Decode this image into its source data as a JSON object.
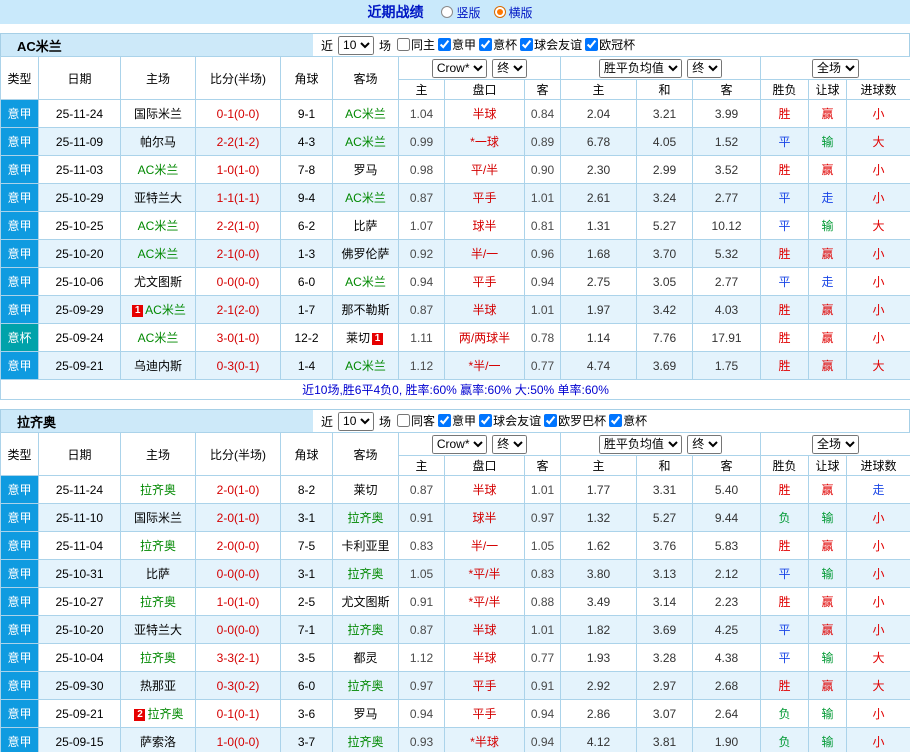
{
  "page": {
    "title": "近期战绩",
    "layout_options": [
      {
        "label": "竖版",
        "selected": false
      },
      {
        "label": "横版",
        "selected": true
      }
    ]
  },
  "labels": {
    "recent": "近",
    "games": "场"
  },
  "columns": {
    "type": "类型",
    "date": "日期",
    "home": "主场",
    "score": "比分(半场)",
    "corner": "角球",
    "away": "客场",
    "h": "主",
    "handicap": "盘口",
    "a": "客",
    "eh": "主",
    "draw": "和",
    "ea": "客",
    "result": "胜负",
    "let": "让球",
    "goals": "进球数"
  },
  "controls": {
    "company": "Crow*",
    "final": "终",
    "eu_mean": "胜平负均值",
    "scope": "全场"
  },
  "colors": {
    "league": {
      "意甲": "#0f9be0",
      "意杯": "#00a2aa"
    },
    "subject_team": "#008800",
    "win": "#e00000",
    "draw": "#1a46e6",
    "lose": "#009933",
    "link_blue": "#0017c4"
  },
  "sections": [
    {
      "team": "AC米兰",
      "count": "10",
      "filters": [
        {
          "label": "同主",
          "checked": false
        },
        {
          "label": "意甲",
          "checked": true
        },
        {
          "label": "意杯",
          "checked": true
        },
        {
          "label": "球会友谊",
          "checked": true
        },
        {
          "label": "欧冠杯",
          "checked": true
        }
      ],
      "rows": [
        {
          "league": "意甲",
          "date": "25-11-24",
          "home": "国际米兰",
          "home_green": false,
          "home_badge": "",
          "score": "0-1(0-0)",
          "corner": "9-1",
          "away": "AC米兰",
          "away_green": true,
          "away_badge": "",
          "odds_home": "1.04",
          "handicap": "半球",
          "odds_away": "0.84",
          "eu_home": "2.04",
          "eu_draw": "3.21",
          "eu_away": "3.99",
          "result": "胜",
          "handicap_result": "赢",
          "goals_result": "小"
        },
        {
          "league": "意甲",
          "date": "25-11-09",
          "home": "帕尔马",
          "home_green": false,
          "home_badge": "",
          "score": "2-2(1-2)",
          "corner": "4-3",
          "away": "AC米兰",
          "away_green": true,
          "away_badge": "",
          "odds_home": "0.99",
          "handicap": "*一球",
          "odds_away": "0.89",
          "eu_home": "6.78",
          "eu_draw": "4.05",
          "eu_away": "1.52",
          "result": "平",
          "handicap_result": "输",
          "goals_result": "大"
        },
        {
          "league": "意甲",
          "date": "25-11-03",
          "home": "AC米兰",
          "home_green": true,
          "home_badge": "",
          "score": "1-0(1-0)",
          "corner": "7-8",
          "away": "罗马",
          "away_green": false,
          "away_badge": "",
          "odds_home": "0.98",
          "handicap": "平/半",
          "odds_away": "0.90",
          "eu_home": "2.30",
          "eu_draw": "2.99",
          "eu_away": "3.52",
          "result": "胜",
          "handicap_result": "赢",
          "goals_result": "小"
        },
        {
          "league": "意甲",
          "date": "25-10-29",
          "home": "亚特兰大",
          "home_green": false,
          "home_badge": "",
          "score": "1-1(1-1)",
          "corner": "9-4",
          "away": "AC米兰",
          "away_green": true,
          "away_badge": "",
          "odds_home": "0.87",
          "handicap": "平手",
          "odds_away": "1.01",
          "eu_home": "2.61",
          "eu_draw": "3.24",
          "eu_away": "2.77",
          "result": "平",
          "handicap_result": "走",
          "goals_result": "小"
        },
        {
          "league": "意甲",
          "date": "25-10-25",
          "home": "AC米兰",
          "home_green": true,
          "home_badge": "",
          "score": "2-2(1-0)",
          "corner": "6-2",
          "away": "比萨",
          "away_green": false,
          "away_badge": "",
          "odds_home": "1.07",
          "handicap": "球半",
          "odds_away": "0.81",
          "eu_home": "1.31",
          "eu_draw": "5.27",
          "eu_away": "10.12",
          "result": "平",
          "handicap_result": "输",
          "goals_result": "大"
        },
        {
          "league": "意甲",
          "date": "25-10-20",
          "home": "AC米兰",
          "home_green": true,
          "home_badge": "",
          "score": "2-1(0-0)",
          "corner": "1-3",
          "away": "佛罗伦萨",
          "away_green": false,
          "away_badge": "",
          "odds_home": "0.92",
          "handicap": "半/一",
          "odds_away": "0.96",
          "eu_home": "1.68",
          "eu_draw": "3.70",
          "eu_away": "5.32",
          "result": "胜",
          "handicap_result": "赢",
          "goals_result": "小"
        },
        {
          "league": "意甲",
          "date": "25-10-06",
          "home": "尤文图斯",
          "home_green": false,
          "home_badge": "",
          "score": "0-0(0-0)",
          "corner": "6-0",
          "away": "AC米兰",
          "away_green": true,
          "away_badge": "",
          "odds_home": "0.94",
          "handicap": "平手",
          "odds_away": "0.94",
          "eu_home": "2.75",
          "eu_draw": "3.05",
          "eu_away": "2.77",
          "result": "平",
          "handicap_result": "走",
          "goals_result": "小"
        },
        {
          "league": "意甲",
          "date": "25-09-29",
          "home": "AC米兰",
          "home_green": true,
          "home_badge": "1",
          "score": "2-1(2-0)",
          "corner": "1-7",
          "away": "那不勒斯",
          "away_green": false,
          "away_badge": "",
          "odds_home": "0.87",
          "handicap": "半球",
          "odds_away": "1.01",
          "eu_home": "1.97",
          "eu_draw": "3.42",
          "eu_away": "4.03",
          "result": "胜",
          "handicap_result": "赢",
          "goals_result": "小"
        },
        {
          "league": "意杯",
          "date": "25-09-24",
          "home": "AC米兰",
          "home_green": true,
          "home_badge": "",
          "score": "3-0(1-0)",
          "corner": "12-2",
          "away": "莱切",
          "away_green": false,
          "away_badge": "1",
          "odds_home": "1.11",
          "handicap": "两/两球半",
          "odds_away": "0.78",
          "eu_home": "1.14",
          "eu_draw": "7.76",
          "eu_away": "17.91",
          "result": "胜",
          "handicap_result": "赢",
          "goals_result": "小"
        },
        {
          "league": "意甲",
          "date": "25-09-21",
          "home": "乌迪内斯",
          "home_green": false,
          "home_badge": "",
          "score": "0-3(0-1)",
          "corner": "1-4",
          "away": "AC米兰",
          "away_green": true,
          "away_badge": "",
          "odds_home": "1.12",
          "handicap": "*半/一",
          "odds_away": "0.77",
          "eu_home": "4.74",
          "eu_draw": "3.69",
          "eu_away": "1.75",
          "result": "胜",
          "handicap_result": "赢",
          "goals_result": "大"
        }
      ],
      "summary": "近10场,胜6平4负0, 胜率:60% 赢率:60% 大:50% 单率:60%"
    },
    {
      "team": "拉齐奥",
      "count": "10",
      "filters": [
        {
          "label": "同客",
          "checked": false
        },
        {
          "label": "意甲",
          "checked": true
        },
        {
          "label": "球会友谊",
          "checked": true
        },
        {
          "label": "欧罗巴杯",
          "checked": true
        },
        {
          "label": "意杯",
          "checked": true
        }
      ],
      "rows": [
        {
          "league": "意甲",
          "date": "25-11-24",
          "home": "拉齐奥",
          "home_green": true,
          "home_badge": "",
          "score": "2-0(1-0)",
          "corner": "8-2",
          "away": "莱切",
          "away_green": false,
          "away_badge": "",
          "odds_home": "0.87",
          "handicap": "半球",
          "odds_away": "1.01",
          "eu_home": "1.77",
          "eu_draw": "3.31",
          "eu_away": "5.40",
          "result": "胜",
          "handicap_result": "赢",
          "goals_result": "走"
        },
        {
          "league": "意甲",
          "date": "25-11-10",
          "home": "国际米兰",
          "home_green": false,
          "home_badge": "",
          "score": "2-0(1-0)",
          "corner": "3-1",
          "away": "拉齐奥",
          "away_green": true,
          "away_badge": "",
          "odds_home": "0.91",
          "handicap": "球半",
          "odds_away": "0.97",
          "eu_home": "1.32",
          "eu_draw": "5.27",
          "eu_away": "9.44",
          "result": "负",
          "handicap_result": "输",
          "goals_result": "小"
        },
        {
          "league": "意甲",
          "date": "25-11-04",
          "home": "拉齐奥",
          "home_green": true,
          "home_badge": "",
          "score": "2-0(0-0)",
          "corner": "7-5",
          "away": "卡利亚里",
          "away_green": false,
          "away_badge": "",
          "odds_home": "0.83",
          "handicap": "半/一",
          "odds_away": "1.05",
          "eu_home": "1.62",
          "eu_draw": "3.76",
          "eu_away": "5.83",
          "result": "胜",
          "handicap_result": "赢",
          "goals_result": "小"
        },
        {
          "league": "意甲",
          "date": "25-10-31",
          "home": "比萨",
          "home_green": false,
          "home_badge": "",
          "score": "0-0(0-0)",
          "corner": "3-1",
          "away": "拉齐奥",
          "away_green": true,
          "away_badge": "",
          "odds_home": "1.05",
          "handicap": "*平/半",
          "odds_away": "0.83",
          "eu_home": "3.80",
          "eu_draw": "3.13",
          "eu_away": "2.12",
          "result": "平",
          "handicap_result": "输",
          "goals_result": "小"
        },
        {
          "league": "意甲",
          "date": "25-10-27",
          "home": "拉齐奥",
          "home_green": true,
          "home_badge": "",
          "score": "1-0(1-0)",
          "corner": "2-5",
          "away": "尤文图斯",
          "away_green": false,
          "away_badge": "",
          "odds_home": "0.91",
          "handicap": "*平/半",
          "odds_away": "0.88",
          "eu_home": "3.49",
          "eu_draw": "3.14",
          "eu_away": "2.23",
          "result": "胜",
          "handicap_result": "赢",
          "goals_result": "小"
        },
        {
          "league": "意甲",
          "date": "25-10-20",
          "home": "亚特兰大",
          "home_green": false,
          "home_badge": "",
          "score": "0-0(0-0)",
          "corner": "7-1",
          "away": "拉齐奥",
          "away_green": true,
          "away_badge": "",
          "odds_home": "0.87",
          "handicap": "半球",
          "odds_away": "1.01",
          "eu_home": "1.82",
          "eu_draw": "3.69",
          "eu_away": "4.25",
          "result": "平",
          "handicap_result": "赢",
          "goals_result": "小"
        },
        {
          "league": "意甲",
          "date": "25-10-04",
          "home": "拉齐奥",
          "home_green": true,
          "home_badge": "",
          "score": "3-3(2-1)",
          "corner": "3-5",
          "away": "都灵",
          "away_green": false,
          "away_badge": "",
          "odds_home": "1.12",
          "handicap": "半球",
          "odds_away": "0.77",
          "eu_home": "1.93",
          "eu_draw": "3.28",
          "eu_away": "4.38",
          "result": "平",
          "handicap_result": "输",
          "goals_result": "大"
        },
        {
          "league": "意甲",
          "date": "25-09-30",
          "home": "热那亚",
          "home_green": false,
          "home_badge": "",
          "score": "0-3(0-2)",
          "corner": "6-0",
          "away": "拉齐奥",
          "away_green": true,
          "away_badge": "",
          "odds_home": "0.97",
          "handicap": "平手",
          "odds_away": "0.91",
          "eu_home": "2.92",
          "eu_draw": "2.97",
          "eu_away": "2.68",
          "result": "胜",
          "handicap_result": "赢",
          "goals_result": "大"
        },
        {
          "league": "意甲",
          "date": "25-09-21",
          "home": "拉齐奥",
          "home_green": true,
          "home_badge": "2",
          "score": "0-1(0-1)",
          "corner": "3-6",
          "away": "罗马",
          "away_green": false,
          "away_badge": "",
          "odds_home": "0.94",
          "handicap": "平手",
          "odds_away": "0.94",
          "eu_home": "2.86",
          "eu_draw": "3.07",
          "eu_away": "2.64",
          "result": "负",
          "handicap_result": "输",
          "goals_result": "小"
        },
        {
          "league": "意甲",
          "date": "25-09-15",
          "home": "萨索洛",
          "home_green": false,
          "home_badge": "",
          "score": "1-0(0-0)",
          "corner": "3-7",
          "away": "拉齐奥",
          "away_green": true,
          "away_badge": "",
          "odds_home": "0.93",
          "handicap": "*半球",
          "odds_away": "0.94",
          "eu_home": "4.12",
          "eu_draw": "3.81",
          "eu_away": "1.90",
          "result": "负",
          "handicap_result": "输",
          "goals_result": "小"
        }
      ],
      "summary": ""
    }
  ]
}
